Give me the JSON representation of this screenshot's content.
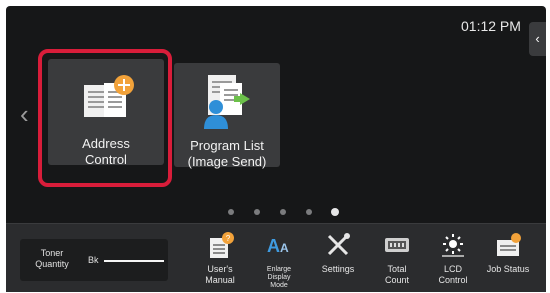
{
  "status": {
    "time": "01:12 PM"
  },
  "home": {
    "side_tab_glyph": "‹",
    "left_arrow_glyph": "‹",
    "tiles": [
      {
        "label_line1": "Address",
        "label_line2": "Control",
        "icon": "address-book-add-icon"
      },
      {
        "label_line1": "Program List",
        "label_line2": "(Image Send)",
        "icon": "program-list-icon"
      }
    ],
    "page_indicator": {
      "count": 5,
      "active_index": 4
    }
  },
  "bottom_bar": {
    "toner": {
      "label_line1": "Toner",
      "label_line2": "Quantity",
      "color_label": "Bk",
      "level": 1.0
    },
    "items": [
      {
        "label_line1": "User's",
        "label_line2": "Manual",
        "icon": "users-manual-icon"
      },
      {
        "label_line1": "Enlarge",
        "label_line2": "Display",
        "label_line3": "Mode",
        "icon": "enlarge-display-icon"
      },
      {
        "label_line1": "Settings",
        "icon": "settings-icon"
      },
      {
        "label_line1": "Total",
        "label_line2": "Count",
        "icon": "total-count-icon"
      },
      {
        "label_line1": "LCD",
        "label_line2": "Control",
        "icon": "lcd-control-icon"
      },
      {
        "label_line1": "Job Status",
        "icon": "job-status-icon"
      }
    ]
  },
  "colors": {
    "highlight": "#d81d3a",
    "accent_orange": "#f2a23a",
    "accent_green": "#6cc04a",
    "accent_blue": "#2f8fd8"
  }
}
